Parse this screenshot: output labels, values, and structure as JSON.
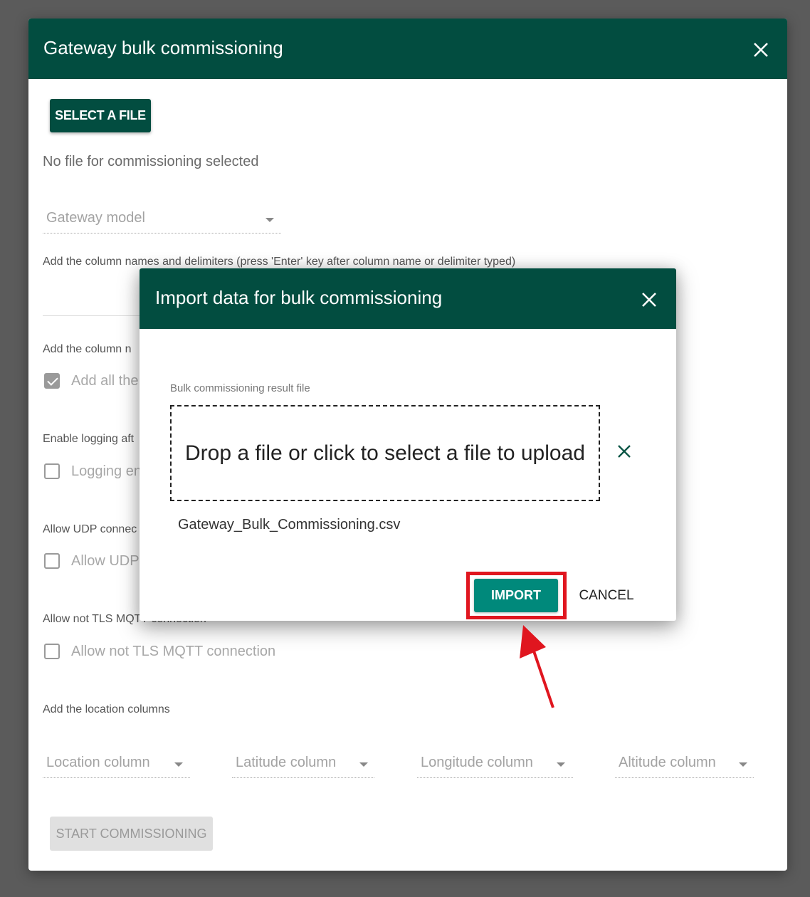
{
  "outer_dialog": {
    "title": "Gateway bulk commissioning",
    "close_icon": "close-icon",
    "select_file_label": "SELECT A FILE",
    "file_status": "No file for commissioning selected",
    "gateway_model_placeholder": "Gateway model",
    "column_names_label": "Add the column names and delimiters (press 'Enter' key after column name or delimiter typed)",
    "add_columns_label": "Add the column n",
    "add_all_checkbox": {
      "label": "Add all the",
      "checked": true
    },
    "logging_label": "Enable logging aft",
    "logging_checkbox": {
      "label": "Logging en",
      "checked": false
    },
    "udp_label": "Allow UDP connec",
    "udp_checkbox": {
      "label": "Allow UDP",
      "checked": false
    },
    "tls_label": "Allow not TLS MQTT connection",
    "tls_checkbox": {
      "label": "Allow not TLS MQTT connection",
      "checked": false
    },
    "location_label": "Add the location columns",
    "location_selects": [
      {
        "placeholder": "Location column"
      },
      {
        "placeholder": "Latitude column"
      },
      {
        "placeholder": "Longitude column"
      },
      {
        "placeholder": "Altitude column"
      }
    ],
    "start_label": "START COMMISSIONING"
  },
  "import_dialog": {
    "title": "Import data for bulk commissioning",
    "close_icon": "close-icon",
    "result_file_label": "Bulk commissioning result file",
    "dropzone_text": "Drop a file or click to select a file to upload",
    "remove_file_icon": "close-icon",
    "selected_file": "Gateway_Bulk_Commissioning.csv",
    "import_label": "IMPORT",
    "cancel_label": "CANCEL"
  },
  "annotation": {
    "highlight_color": "#e0161f",
    "target": "IMPORT"
  },
  "colors": {
    "header": "#024d40",
    "primary_button": "#00897b",
    "overlay": "#5b5b5b"
  }
}
